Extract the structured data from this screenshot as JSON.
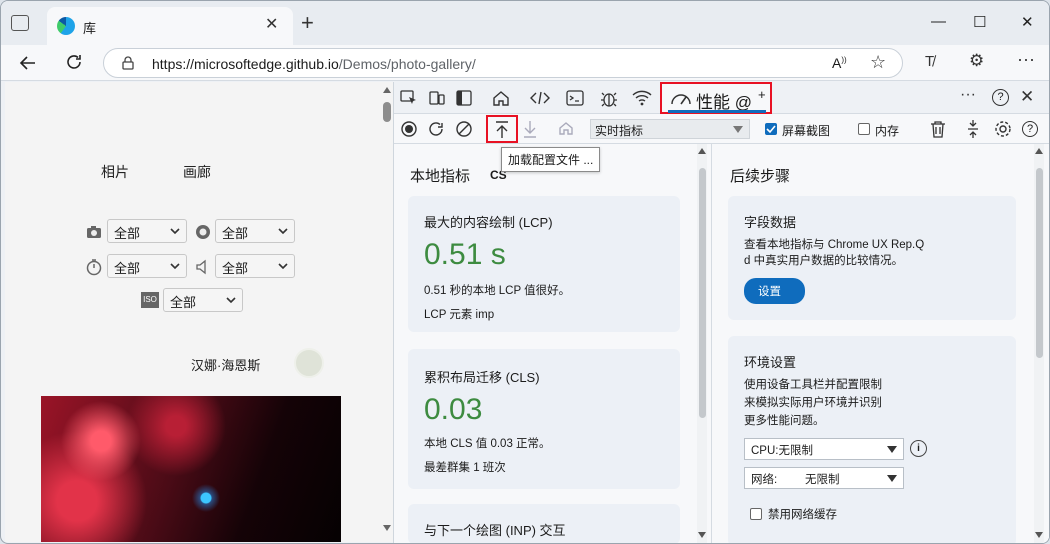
{
  "tab": {
    "title": "库"
  },
  "window_buttons": {
    "minimize": "—",
    "maximize": "☐",
    "close": "✕"
  },
  "address": {
    "url_host": "https://microsoftedge.github.io",
    "url_path": "/Demos/photo-gallery/"
  },
  "page": {
    "links": [
      "相片",
      "画廊"
    ],
    "filters": [
      {
        "icon": "camera-icon",
        "value": "全部"
      },
      {
        "icon": "aperture-icon",
        "value": "全部"
      },
      {
        "icon": "timer-icon",
        "value": "全部"
      },
      {
        "icon": "speaker-icon",
        "value": "全部"
      },
      {
        "icon": "iso-icon",
        "value": "全部"
      }
    ],
    "iso_label": "ISO",
    "author": "汉娜·海恩斯"
  },
  "devtools": {
    "perf_tab_label": "性能",
    "perf_tab_suffix": "@",
    "plus": "+",
    "metric_select": "实时指标",
    "screenshot_label": "屏幕截图",
    "screenshot_checked": true,
    "memory_label": "内存",
    "memory_checked": false,
    "tooltip": "加载配置文件 ..."
  },
  "left": {
    "title": "本地指标",
    "badge": "CS",
    "lcp": {
      "title": "最大的内容绘制 (LCP)",
      "value": "0.51 s",
      "desc": "0.51 秒的本地 LCP 值很好。",
      "element": "LCP 元素 imp"
    },
    "cls": {
      "title": "累积布局迁移 (CLS)",
      "value": "0.03",
      "desc": "本地 CLS 值 0.03 正常。",
      "cluster": "最差群集 1 班次"
    },
    "inp": {
      "title": "与下一个绘图 (INP) 交互"
    }
  },
  "right": {
    "title": "后续步骤",
    "field": {
      "title": "字段数据",
      "line1": "查看本地指标与 Chrome UX Rep.Q",
      "line2": "d 中真实用户数据的比较情况。",
      "button": "设置"
    },
    "env": {
      "title": "环境设置",
      "line1": "使用设备工具栏并配置限制",
      "line2": "来模拟实际用户环境并识别",
      "line3": "更多性能问题。",
      "cpu": "CPU:无限制",
      "net_label": "网络:",
      "net_value": "无限制",
      "cache": "禁用网络缓存"
    }
  }
}
